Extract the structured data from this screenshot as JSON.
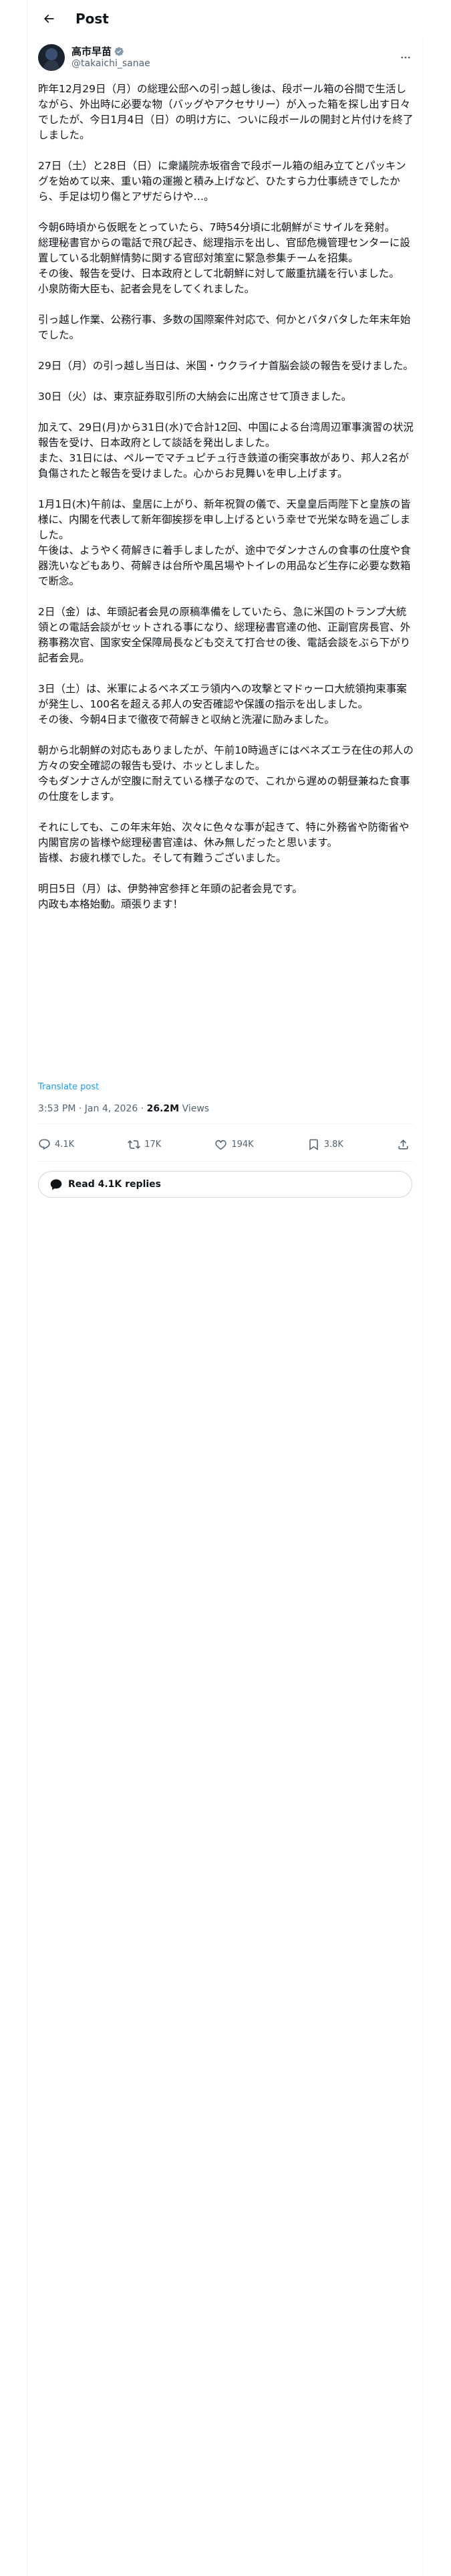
{
  "header": {
    "title": "Post"
  },
  "author": {
    "display_name": "高市早苗",
    "handle": "@takaichi_sanae"
  },
  "post": {
    "text": "昨年12月29日（月）の総理公邸への引っ越し後は、段ボール箱の谷間で生活しながら、外出時に必要な物（バッグやアクセサリー）が入った箱を探し出す日々でしたが、今日1月4日（日）の明け方に、ついに段ボールの開封と片付けを終了しました。\n\n27日（土）と28日（日）に衆議院赤坂宿舎で段ボール箱の組み立てとパッキングを始めて以来、重い箱の運搬と積み上げなど、ひたすら力仕事続きでしたから、手足は切り傷とアザだらけや…。\n\n今朝6時頃から仮眠をとっていたら、7時54分頃に北朝鮮がミサイルを発射。\n総理秘書官からの電話で飛び起き、総理指示を出し、官邸危機管理センターに設置している北朝鮮情勢に関する官邸対策室に緊急参集チームを招集。\nその後、報告を受け、日本政府として北朝鮮に対して厳重抗議を行いました。\n小泉防衛大臣も、記者会見をしてくれました。\n\n引っ越し作業、公務行事、多数の国際案件対応で、何かとバタバタした年末年始でした。\n\n29日（月）の引っ越し当日は、米国・ウクライナ首脳会談の報告を受けました。\n\n30日（火）は、東京証券取引所の大納会に出席させて頂きました。\n\n加えて、29日(月)から31日(水)で合計12回、中国による台湾周辺軍事演習の状況報告を受け、日本政府として談話を発出しました。\nまた、31日には、ペルーでマチュピチュ行き鉄道の衝突事故があり、邦人2名が負傷されたと報告を受けました。心からお見舞いを申し上げます。\n\n1月1日(木)午前は、皇居に上がり、新年祝賀の儀で、天皇皇后両陛下と皇族の皆様に、内閣を代表して新年御挨拶を申し上げるという幸せで光栄な時を過ごしました。\n午後は、ようやく荷解きに着手しましたが、途中でダンナさんの食事の仕度や食器洗いなどもあり、荷解きは台所や風呂場やトイレの用品など生存に必要な数箱で断念。\n\n2日（金）は、年頭記者会見の原稿準備をしていたら、急に米国のトランプ大統領との電話会談がセットされる事になり、総理秘書官達の他、正副官房長官、外務事務次官、国家安全保障局長なども交えて打合せの後、電話会談をぶら下がり記者会見。\n\n3日（土）は、米軍によるベネズエラ領内への攻撃とマドゥーロ大統領拘束事案が発生し、100名を超える邦人の安否確認や保護の指示を出しました。\nその後、今朝4日まで徹夜で荷解きと収納と洗濯に励みました。\n\n朝から北朝鮮の対応もありましたが、午前10時過ぎにはベネズエラ在住の邦人の方々の安全確認の報告も受け、ホッとしました。\n今もダンナさんが空腹に耐えている様子なので、これから遅めの朝昼兼ねた食事の仕度をします。\n\nそれにしても、この年末年始、次々に色々な事が起きて、特に外務省や防衛省や内閣官房の皆様や総理秘書官達は、休み無しだったと思います。\n皆様、お疲れ様でした。そして有難うございました。\n\n明日5日（月）は、伊勢神宮参拝と年頭の記者会見です。\n内政も本格始動。頑張ります！"
  },
  "translate_label": "Translate post",
  "meta": {
    "time": "3:53 PM",
    "sep1": " · ",
    "date": "Jan 4, 2026",
    "sep2": " · ",
    "views_count": "26.2M",
    "views_label": " Views"
  },
  "actions": {
    "replies": "4.1K",
    "reposts": "17K",
    "likes": "194K",
    "bookmarks": "3.8K"
  },
  "read_replies_label": "Read 4.1K replies",
  "icons": [
    "back-arrow-icon",
    "verified-badge-icon",
    "more-icon",
    "reply-icon",
    "repost-icon",
    "like-icon",
    "bookmark-icon",
    "share-icon",
    "chat-bubble-icon"
  ],
  "colors": {
    "link": "#1d9bf0",
    "verified": "#829aab",
    "muted": "#536471",
    "text": "#0f1419"
  }
}
